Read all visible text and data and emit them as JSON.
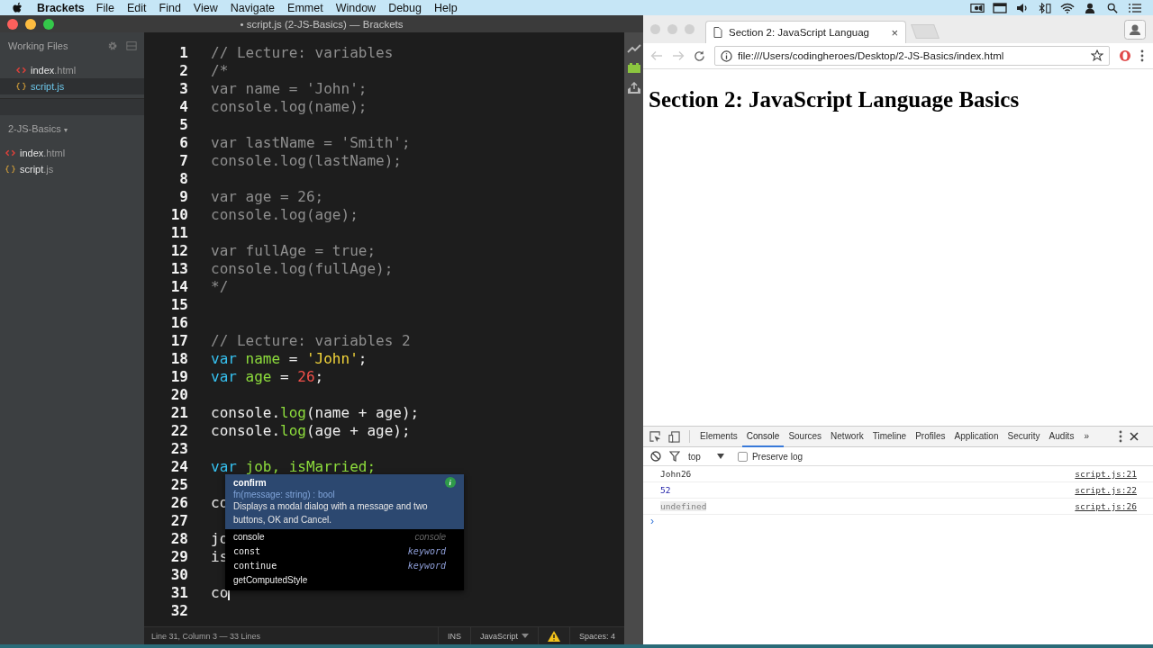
{
  "menubar": {
    "app": "Brackets",
    "items": [
      "File",
      "Edit",
      "Find",
      "View",
      "Navigate",
      "Emmet",
      "Window",
      "Debug",
      "Help"
    ]
  },
  "editor_window": {
    "title": "• script.js (2-JS-Basics) — Brackets",
    "working_files": {
      "label": "Working Files",
      "files": [
        {
          "name": "index",
          "ext": ".html",
          "kind": "html",
          "selected": false
        },
        {
          "name": "script",
          "ext": ".js",
          "kind": "js",
          "selected": true
        }
      ]
    },
    "project": {
      "label": "2-JS-Basics",
      "caret": "▾",
      "files": [
        {
          "name": "index",
          "ext": ".html",
          "kind": "html",
          "selected": false
        },
        {
          "name": "script",
          "ext": ".js",
          "kind": "js",
          "selected": false
        }
      ]
    },
    "lines": [
      {
        "number": "1",
        "tokens": [
          {
            "kind": "comment",
            "text": "// Lecture: variables"
          }
        ]
      },
      {
        "number": "2",
        "tokens": [
          {
            "kind": "comment",
            "text": "/*"
          }
        ]
      },
      {
        "number": "3",
        "tokens": [
          {
            "kind": "comment",
            "text": "var name = 'John';"
          }
        ]
      },
      {
        "number": "4",
        "tokens": [
          {
            "kind": "comment",
            "text": "console.log(name);"
          }
        ]
      },
      {
        "number": "5"
      },
      {
        "number": "6",
        "tokens": [
          {
            "kind": "comment",
            "text": "var lastName = 'Smith';"
          }
        ]
      },
      {
        "number": "7",
        "tokens": [
          {
            "kind": "comment",
            "text": "console.log(lastName);"
          }
        ]
      },
      {
        "number": "8"
      },
      {
        "number": "9",
        "tokens": [
          {
            "kind": "comment",
            "text": "var age = 26;"
          }
        ]
      },
      {
        "number": "10",
        "tokens": [
          {
            "kind": "comment",
            "text": "console.log(age);"
          }
        ]
      },
      {
        "number": "11"
      },
      {
        "number": "12",
        "tokens": [
          {
            "kind": "comment",
            "text": "var fullAge = true;"
          }
        ]
      },
      {
        "number": "13",
        "tokens": [
          {
            "kind": "comment",
            "text": "console.log(fullAge);"
          }
        ]
      },
      {
        "number": "14",
        "tokens": [
          {
            "kind": "comment",
            "text": "*/"
          }
        ]
      },
      {
        "number": "15"
      },
      {
        "number": "16"
      },
      {
        "number": "17",
        "tokens": [
          {
            "kind": "comment",
            "text": "// Lecture: variables 2"
          }
        ]
      },
      {
        "number": "18",
        "tokens": [
          {
            "kind": "keyword",
            "text": "var "
          },
          {
            "kind": "variable",
            "text": "name"
          },
          {
            "kind": "plain",
            "text": " = "
          },
          {
            "kind": "string",
            "text": "'John'"
          },
          {
            "kind": "plain",
            "text": ";"
          }
        ]
      },
      {
        "number": "19",
        "tokens": [
          {
            "kind": "keyword",
            "text": "var "
          },
          {
            "kind": "variable",
            "text": "age"
          },
          {
            "kind": "plain",
            "text": " = "
          },
          {
            "kind": "number",
            "text": "26"
          },
          {
            "kind": "plain",
            "text": ";"
          }
        ]
      },
      {
        "number": "20"
      },
      {
        "number": "21",
        "tokens": [
          {
            "kind": "plain",
            "text": "console."
          },
          {
            "kind": "method",
            "text": "log"
          },
          {
            "kind": "plain",
            "text": "(name + age);"
          }
        ]
      },
      {
        "number": "22",
        "tokens": [
          {
            "kind": "plain",
            "text": "console."
          },
          {
            "kind": "method",
            "text": "log"
          },
          {
            "kind": "plain",
            "text": "(age + age);"
          }
        ]
      },
      {
        "number": "23"
      },
      {
        "number": "24",
        "tokens": [
          {
            "kind": "keyword",
            "text": "var "
          },
          {
            "kind": "variable",
            "text": "job, isMarried;"
          }
        ]
      },
      {
        "number": "25"
      },
      {
        "number": "26",
        "tokens": [
          {
            "kind": "plain",
            "text": "co"
          }
        ]
      },
      {
        "number": "27"
      },
      {
        "number": "28",
        "tokens": [
          {
            "kind": "plain",
            "text": "jo"
          }
        ]
      },
      {
        "number": "29",
        "tokens": [
          {
            "kind": "plain",
            "text": "is"
          }
        ]
      },
      {
        "number": "30"
      },
      {
        "number": "31",
        "tokens": [
          {
            "kind": "plain",
            "text": "co"
          }
        ],
        "cursor": true
      },
      {
        "number": "32"
      }
    ],
    "hint_popup": {
      "name": "confirm",
      "signature": "fn(message: string) : bool",
      "description": "Displays a modal dialog with a message and two buttons, OK and Cancel.",
      "items": [
        {
          "text": "console",
          "type": "console",
          "kind": "property"
        },
        {
          "text": "const",
          "type": "keyword",
          "kind": "keyword"
        },
        {
          "text": "continue",
          "type": "keyword",
          "kind": "keyword"
        },
        {
          "text": "getComputedStyle",
          "kind": "property"
        }
      ]
    },
    "status_bar": {
      "position": "Line 31, Column 3 — 33 Lines",
      "mode": "INS",
      "language": "JavaScript",
      "spaces": "Spaces: 4"
    }
  },
  "browser": {
    "tab": {
      "title": "Section 2: JavaScript Languag",
      "close": "×"
    },
    "address": "file:///Users/codingheroes/Desktop/2-JS-Basics/index.html",
    "heading": "Section 2: JavaScript Language Basics",
    "devtools": {
      "tabs": [
        {
          "label": "Elements",
          "selected": false
        },
        {
          "label": "Console",
          "selected": true
        },
        {
          "label": "Sources",
          "selected": false
        },
        {
          "label": "Network",
          "selected": false
        },
        {
          "label": "Timeline",
          "selected": false
        },
        {
          "label": "Profiles",
          "selected": false
        },
        {
          "label": "Application",
          "selected": false
        },
        {
          "label": "Security",
          "selected": false
        },
        {
          "label": "Audits",
          "selected": false
        }
      ],
      "more": "»",
      "context": "top",
      "preserve_log": {
        "label": "Preserve log",
        "checked": false
      },
      "console_rows": [
        {
          "text": "John26",
          "kind": "string",
          "source": "script.js:21"
        },
        {
          "text": "52",
          "kind": "number",
          "source": "script.js:22"
        },
        {
          "text": "undefined",
          "kind": "undefined",
          "source": "script.js:26"
        }
      ],
      "prompt": "›"
    }
  }
}
